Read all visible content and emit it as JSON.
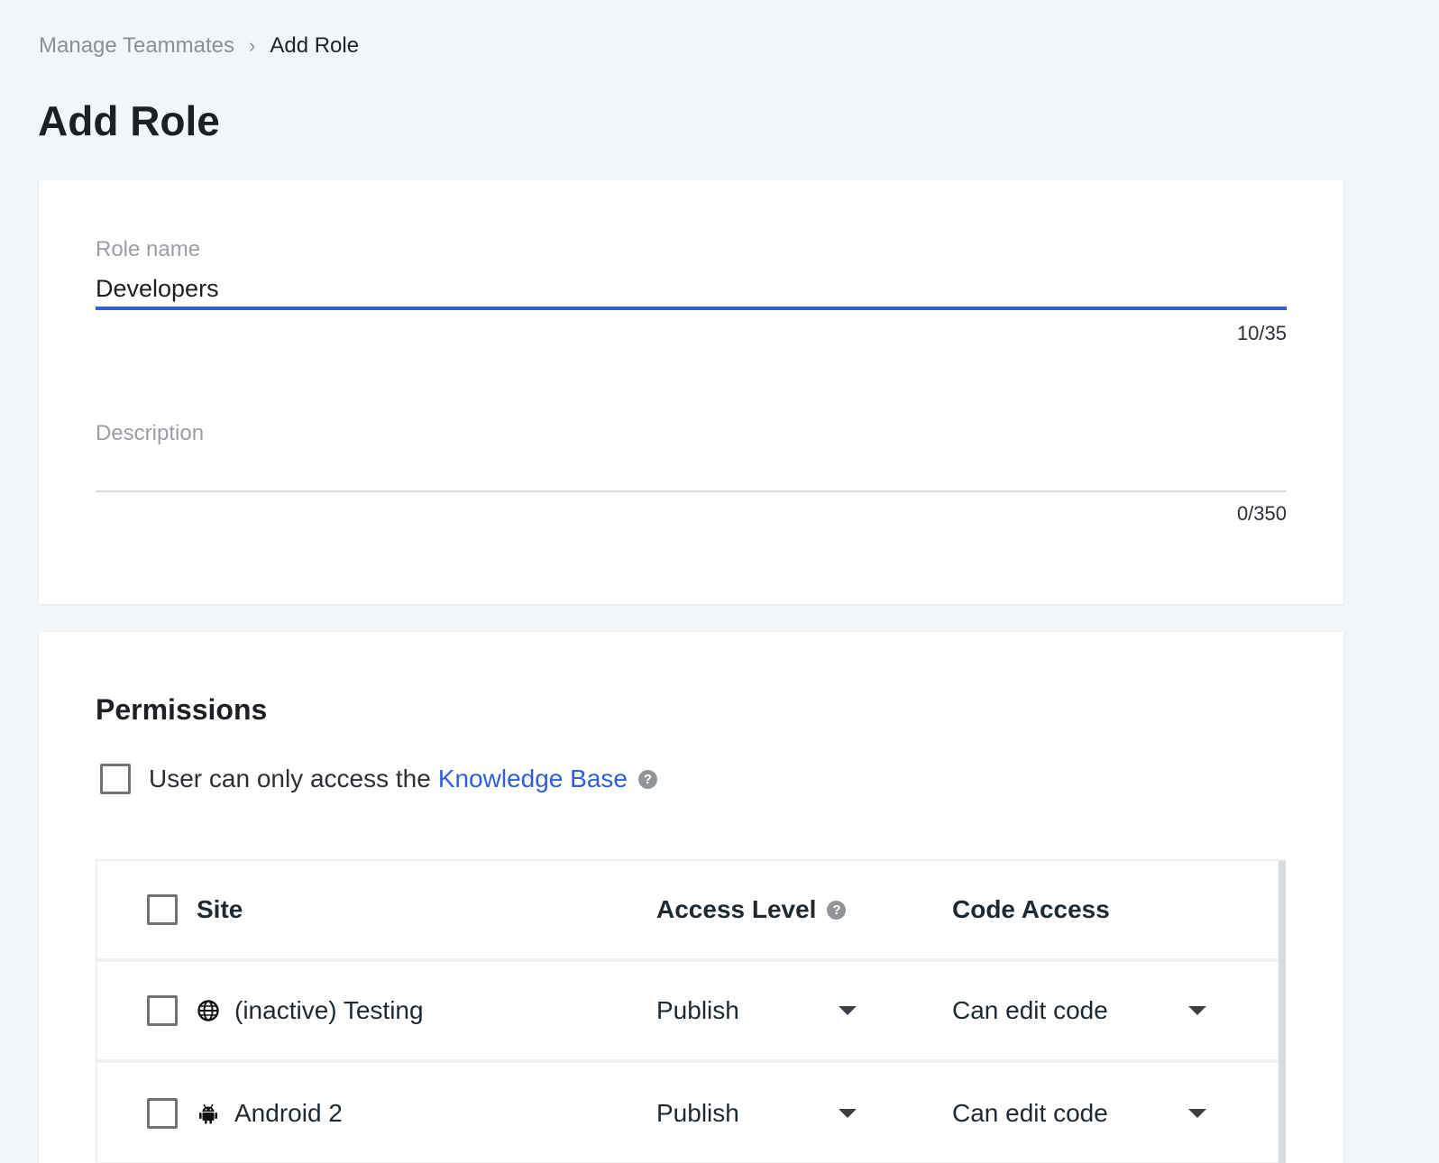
{
  "breadcrumb": {
    "parent": "Manage Teammates",
    "separator": "›",
    "current": "Add Role"
  },
  "page_title": "Add Role",
  "role_form": {
    "role_name_label": "Role name",
    "role_name_value": "Developers",
    "role_name_counter": "10/35",
    "description_label": "Description",
    "description_value": "",
    "description_counter": "0/350"
  },
  "permissions": {
    "title": "Permissions",
    "kb_text": "User can only access the",
    "kb_link": "Knowledge Base",
    "help_glyph": "?",
    "table": {
      "headers": {
        "site": "Site",
        "access_level": "Access Level",
        "code_access": "Code Access"
      },
      "rows": [
        {
          "icon": "globe-icon",
          "site": "(inactive) Testing",
          "access_level": "Publish",
          "code_access": "Can edit code"
        },
        {
          "icon": "android-icon",
          "site": "Android 2",
          "access_level": "Publish",
          "code_access": "Can edit code"
        }
      ]
    }
  },
  "colors": {
    "accent": "#2f5fd8",
    "background": "#f3f6f9"
  }
}
